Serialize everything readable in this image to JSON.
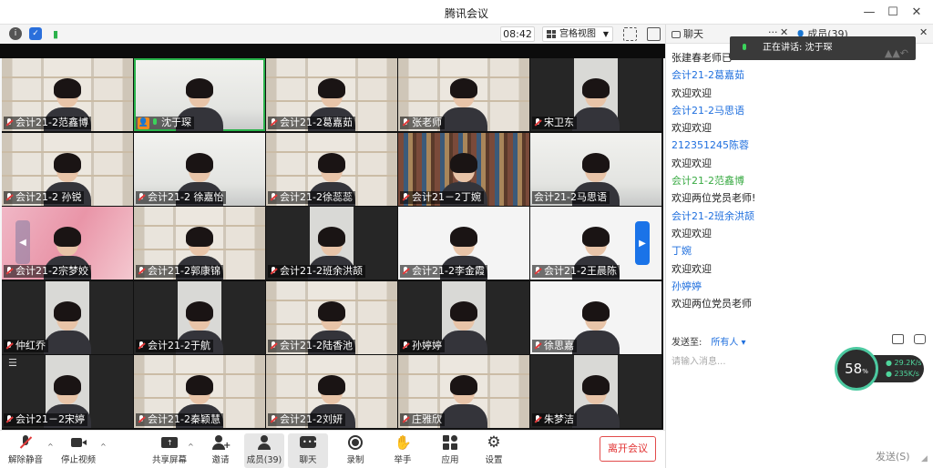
{
  "window": {
    "title": "腾讯会议"
  },
  "toolbar": {
    "time": "08:42",
    "view_label": "宫格视图"
  },
  "tiles": [
    {
      "name": "会计21-2范鑫博",
      "bg": "shelf",
      "mic": "off"
    },
    {
      "name": "沈于琛",
      "bg": "room",
      "mic": "on",
      "host": true,
      "active": true
    },
    {
      "name": "会计21-2葛嘉茹",
      "bg": "shelf",
      "mic": "off"
    },
    {
      "name": "张老师",
      "bg": "shelf",
      "mic": "off"
    },
    {
      "name": "宋卫东",
      "bg": "dark",
      "mic": "off"
    },
    {
      "name": "会计21-2 孙锐",
      "bg": "shelf",
      "mic": "off"
    },
    {
      "name": "会计21-2 徐嘉怡",
      "bg": "room",
      "mic": "off"
    },
    {
      "name": "会计21-2徐蕊蕊",
      "bg": "shelf",
      "mic": "off"
    },
    {
      "name": "会计21－2丁婉",
      "bg": "books",
      "mic": "off"
    },
    {
      "name": "会计21-2马思语",
      "bg": "room",
      "mic": "none"
    },
    {
      "name": "会计21-2宗梦姣",
      "bg": "pink",
      "mic": "off"
    },
    {
      "name": "会计21-2郭康锦",
      "bg": "shelf",
      "mic": "off"
    },
    {
      "name": "会计21-2班余洪颉",
      "bg": "dark",
      "mic": "off"
    },
    {
      "name": "会计21-2李金霞",
      "bg": "white",
      "mic": "off"
    },
    {
      "name": "会计21-2王晨陈",
      "bg": "white",
      "mic": "off"
    },
    {
      "name": "仲红乔",
      "bg": "dark",
      "mic": "off"
    },
    {
      "name": "会计21-2于航",
      "bg": "dark",
      "mic": "off"
    },
    {
      "name": "会计21-2陆香池",
      "bg": "shelf",
      "mic": "off"
    },
    {
      "name": "孙婷婷",
      "bg": "dark",
      "mic": "off"
    },
    {
      "name": "徐思嘉",
      "bg": "white",
      "mic": "off"
    },
    {
      "name": "会计21－2宋婷",
      "bg": "dark",
      "mic": "off"
    },
    {
      "name": "会计21-2秦颖慧",
      "bg": "shelf",
      "mic": "off"
    },
    {
      "name": "会计21-2刘妍",
      "bg": "shelf",
      "mic": "off"
    },
    {
      "name": "庄雅欣",
      "bg": "shelf",
      "mic": "off"
    },
    {
      "name": "朱梦洁",
      "bg": "dark",
      "mic": "off"
    }
  ],
  "controls": {
    "unmute": "解除静音",
    "stop_video": "停止视频",
    "share": "共享屏幕",
    "invite": "邀请",
    "members": "成员(39)",
    "chat": "聊天",
    "record": "录制",
    "raise_hand": "举手",
    "apps": "应用",
    "settings": "设置",
    "leave": "离开会议"
  },
  "panel": {
    "tab_chat": "聊天",
    "tab_members": "成员(39)",
    "speaking_label": "正在讲话: 沈于琛",
    "messages": [
      {
        "type": "text",
        "text": "张建春老师已"
      },
      {
        "type": "name",
        "text": "会计21-2葛嘉茹"
      },
      {
        "type": "text",
        "text": "欢迎欢迎"
      },
      {
        "type": "name",
        "text": "会计21-2马思语"
      },
      {
        "type": "text",
        "text": "欢迎欢迎"
      },
      {
        "type": "name",
        "text": "212351245陈蓉"
      },
      {
        "type": "text",
        "text": "欢迎欢迎"
      },
      {
        "type": "name-green",
        "text": "会计21-2范鑫博"
      },
      {
        "type": "text",
        "text": "欢迎两位党员老师!"
      },
      {
        "type": "name",
        "text": "会计21-2班余洪颉"
      },
      {
        "type": "text",
        "text": "欢迎欢迎"
      },
      {
        "type": "name",
        "text": "丁婉"
      },
      {
        "type": "text",
        "text": "欢迎欢迎"
      },
      {
        "type": "name",
        "text": "孙婷婷"
      },
      {
        "type": "text",
        "text": "欢迎两位党员老师"
      }
    ],
    "send_to_label": "发送至:",
    "send_target": "所有人 ▾",
    "input_placeholder": "请输入消息...",
    "send_button": "发送(S)"
  },
  "meter": {
    "percent": "58",
    "percent_unit": "%",
    "up_speed": "29.2K/s",
    "down_speed": "235K/s"
  },
  "colors": {
    "accent": "#1f6fde",
    "leave_red": "#e23232",
    "active_green": "#29b34b"
  }
}
